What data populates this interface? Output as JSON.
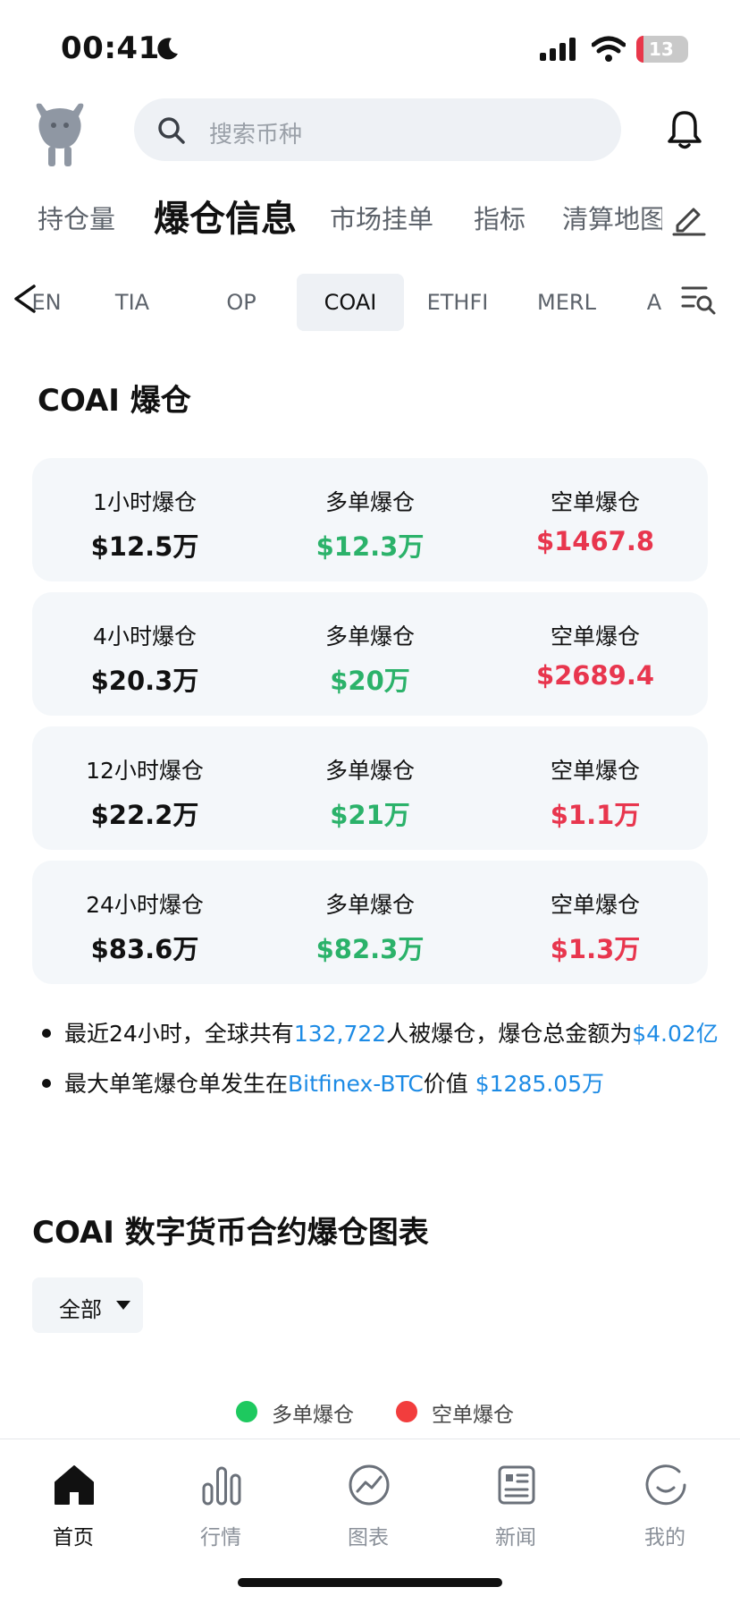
{
  "status_bar": {
    "time": "00:41",
    "battery": "13"
  },
  "header": {
    "search_placeholder": "搜索币种"
  },
  "top_tabs": [
    {
      "label": "持仓量",
      "active": false
    },
    {
      "label": "爆仓信息",
      "active": true
    },
    {
      "label": "市场挂单",
      "active": false
    },
    {
      "label": "指标",
      "active": false
    },
    {
      "label": "清算地图",
      "active": false
    }
  ],
  "coin_tabs": [
    {
      "label": "EN",
      "active": false
    },
    {
      "label": "TIA",
      "active": false
    },
    {
      "label": "OP",
      "active": false
    },
    {
      "label": "COAI",
      "active": true
    },
    {
      "label": "ETHFI",
      "active": false
    },
    {
      "label": "MERL",
      "active": false
    },
    {
      "label": "A",
      "active": false
    }
  ],
  "section": {
    "title": "COAI 爆仓"
  },
  "stats": [
    {
      "period": "1小时爆仓",
      "total": "$12.5万",
      "long_label": "多单爆仓",
      "long": "$12.3万",
      "short_label": "空单爆仓",
      "short": "$1467.8"
    },
    {
      "period": "4小时爆仓",
      "total": "$20.3万",
      "long_label": "多单爆仓",
      "long": "$20万",
      "short_label": "空单爆仓",
      "short": "$2689.4"
    },
    {
      "period": "12小时爆仓",
      "total": "$22.2万",
      "long_label": "多单爆仓",
      "long": "$21万",
      "short_label": "空单爆仓",
      "short": "$1.1万"
    },
    {
      "period": "24小时爆仓",
      "total": "$83.6万",
      "long_label": "多单爆仓",
      "long": "$82.3万",
      "short_label": "空单爆仓",
      "short": "$1.3万"
    }
  ],
  "summary": {
    "line1_prefix": "最近24小时，全球共有",
    "line1_count": "132,722",
    "line1_mid": "人被爆仓，爆仓总金额为",
    "line1_amount": "$4.02亿",
    "line2_prefix": "最大单笔爆仓单发生在",
    "line2_exchange": "Bitfinex-BTC",
    "line2_mid": "价值 ",
    "line2_amount": "$1285.05万"
  },
  "chart_section": {
    "title": "COAI 数字货币合约爆仓图表",
    "dropdown_value": "全部",
    "legend_long": "多单爆仓",
    "legend_short": "空单爆仓",
    "long_color": "#1ec95f",
    "short_color": "#f23d3d"
  },
  "bottom_nav": [
    {
      "label": "首页",
      "icon": "home-icon",
      "active": true
    },
    {
      "label": "行情",
      "icon": "market-bars-icon",
      "active": false
    },
    {
      "label": "图表",
      "icon": "chart-trend-icon",
      "active": false
    },
    {
      "label": "新闻",
      "icon": "news-icon",
      "active": false
    },
    {
      "label": "我的",
      "icon": "profile-icon",
      "active": false
    }
  ]
}
